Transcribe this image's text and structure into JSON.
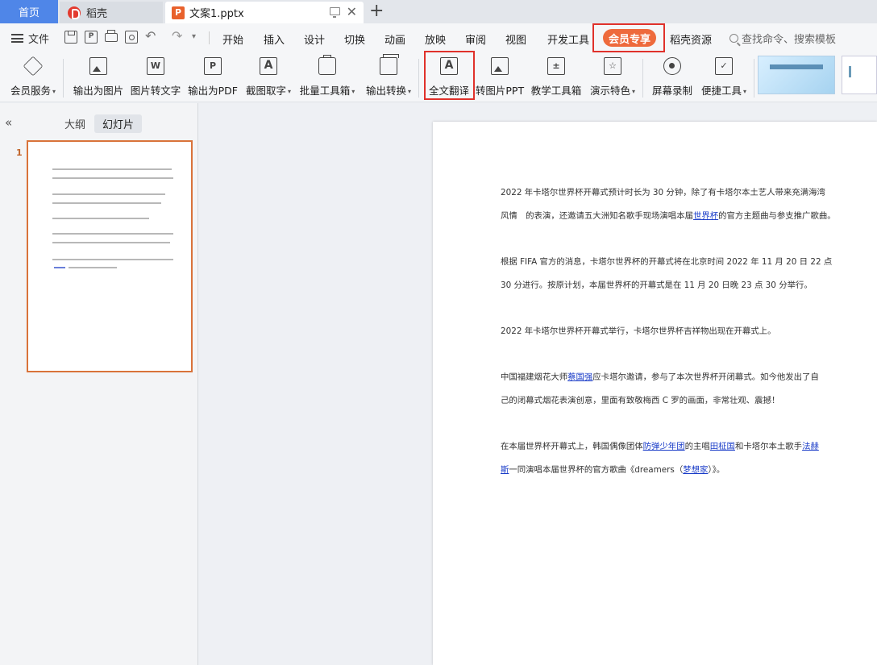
{
  "tabs": {
    "home": "首页",
    "daoke": "稻壳",
    "doc": "文案1.pptx"
  },
  "menubar": {
    "file": "文件",
    "items": [
      "开始",
      "插入",
      "设计",
      "切换",
      "动画",
      "放映",
      "审阅",
      "视图",
      "开发工具"
    ],
    "member": "会员专享",
    "resources": "稻壳资源",
    "search_placeholder": "查找命令、搜索模板"
  },
  "ribbon": {
    "items": [
      {
        "label": "会员服务",
        "icon": "diamond-icon",
        "dropdown": true
      },
      {
        "label": "输出为图片",
        "icon": "image-export-icon",
        "dropdown": false
      },
      {
        "label": "图片转文字",
        "icon": "image-to-text-icon",
        "dropdown": false
      },
      {
        "label": "输出为PDF",
        "icon": "pdf-export-icon",
        "dropdown": false
      },
      {
        "label": "截图取字",
        "icon": "screenshot-text-icon",
        "dropdown": true
      },
      {
        "label": "批量工具箱",
        "icon": "toolbox-icon",
        "dropdown": true
      },
      {
        "label": "输出转换",
        "icon": "convert-icon",
        "dropdown": true
      },
      {
        "label": "全文翻译",
        "icon": "translate-icon",
        "dropdown": false
      },
      {
        "label": "转图片PPT",
        "icon": "image-ppt-icon",
        "dropdown": false
      },
      {
        "label": "教学工具箱",
        "icon": "teaching-toolbox-icon",
        "dropdown": false
      },
      {
        "label": "演示特色",
        "icon": "presentation-star-icon",
        "dropdown": true
      },
      {
        "label": "屏幕录制",
        "icon": "screen-record-icon",
        "dropdown": false
      },
      {
        "label": "便捷工具",
        "icon": "quick-tools-icon",
        "dropdown": true
      }
    ]
  },
  "leftpanel": {
    "outline": "大纲",
    "slides": "幻灯片",
    "slide_number": "1"
  },
  "slide": {
    "p1_l1": "2022 年卡塔尔世界杯开幕式预计时长为 30 分钟，除了有卡塔尔本土艺人带来充满海湾",
    "p1_l2a": "风情　的表演，还邀请五大洲知名歌手现场演唱本届",
    "p1_l2_link": "世界杯",
    "p1_l2b": "的官方主题曲与参支推广歌曲。",
    "p2_l1": "根据 FIFA 官方的消息，卡塔尔世界杯的开幕式将在北京时间 2022 年 11 月 20 日 22 点",
    "p2_l2": "30 分进行。按原计划，本届世界杯的开幕式是在 11 月 20 日晚 23 点 30 分举行。",
    "p3_l1": "2022 年卡塔尔世界杯开幕式举行，卡塔尔世界杯吉祥物出现在开幕式上。",
    "p4_l1a": "中国福建烟花大师",
    "p4_l1_link": "蔡国强",
    "p4_l1b": "应卡塔尔邀请，参与了本次世界杯开闭幕式。如今他发出了自",
    "p4_l2": "己的闭幕式烟花表演创意，里面有致敬梅西 C 罗的画面，非常壮观、震撼！",
    "p5_l1a": "在本届世界杯开幕式上，韩国偶像团体",
    "p5_l1_link1": "防弹少年团",
    "p5_l1b": "的主唱",
    "p5_l1_link2": "田柾国",
    "p5_l1c": "和卡塔尔本土歌手",
    "p5_l1_link3": "法赫",
    "p5_l2_link": "斯",
    "p5_l2a": "一同演唱本届世界杯的官方歌曲《dreamers（",
    "p5_l2_link2": "梦想家",
    "p5_l2b": "）》。"
  },
  "colors": {
    "accent_blue": "#4f86e8",
    "member_orange": "#ee6a3c",
    "highlight_red": "#e0312b",
    "link_blue": "#1a3cc8"
  }
}
